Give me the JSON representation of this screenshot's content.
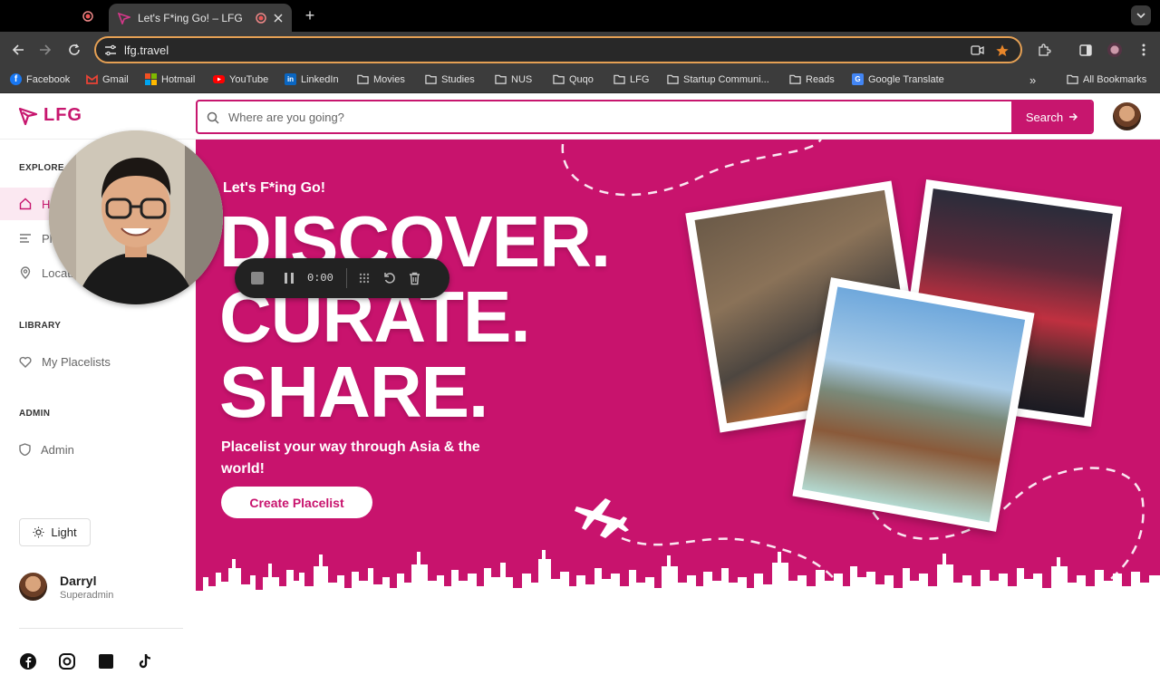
{
  "browser": {
    "tab_title": "Let's F*ing Go! – LFG",
    "url": "lfg.travel",
    "bookmarks": [
      {
        "label": "Facebook",
        "icon": "facebook-icon"
      },
      {
        "label": "Gmail",
        "icon": "gmail-icon"
      },
      {
        "label": "Hotmail",
        "icon": "microsoft-icon"
      },
      {
        "label": "YouTube",
        "icon": "youtube-icon"
      },
      {
        "label": "LinkedIn",
        "icon": "linkedin-icon"
      },
      {
        "label": "Movies",
        "icon": "folder-icon"
      },
      {
        "label": "Studies",
        "icon": "folder-icon"
      },
      {
        "label": "NUS",
        "icon": "folder-icon"
      },
      {
        "label": "Quqo",
        "icon": "folder-icon"
      },
      {
        "label": "LFG",
        "icon": "folder-icon"
      },
      {
        "label": "Startup Communi...",
        "icon": "folder-icon"
      },
      {
        "label": "Reads",
        "icon": "folder-icon"
      },
      {
        "label": "Google Translate",
        "icon": "translate-icon"
      }
    ],
    "all_bookmarks": "All Bookmarks",
    "accent_color": "#e5a054"
  },
  "app": {
    "logo": "LFG",
    "brand_color": "#c7166e",
    "search": {
      "placeholder": "Where are you going?",
      "button_label": "Search"
    }
  },
  "sidebar": {
    "sections": [
      {
        "label": "EXPLORE",
        "items": [
          {
            "label": "Home",
            "icon": "home-icon",
            "active": true
          },
          {
            "label": "Placelists",
            "icon": "list-icon"
          },
          {
            "label": "Locations",
            "icon": "location-pin-icon"
          }
        ]
      },
      {
        "label": "LIBRARY",
        "items": [
          {
            "label": "My Placelists",
            "icon": "heart-icon"
          }
        ]
      },
      {
        "label": "ADMIN",
        "items": [
          {
            "label": "Admin",
            "icon": "shield-icon"
          }
        ]
      }
    ],
    "theme_label": "Light",
    "user": {
      "name": "Darryl",
      "role": "Superadmin"
    }
  },
  "hero": {
    "tagline": "Let's F*ing Go!",
    "headline": [
      "DISCOVER.",
      "CURATE.",
      "SHARE."
    ],
    "subtitle": "Placelist your way through Asia & the world!",
    "cta_label": "Create Placelist"
  },
  "recorder": {
    "time": "0:00"
  }
}
